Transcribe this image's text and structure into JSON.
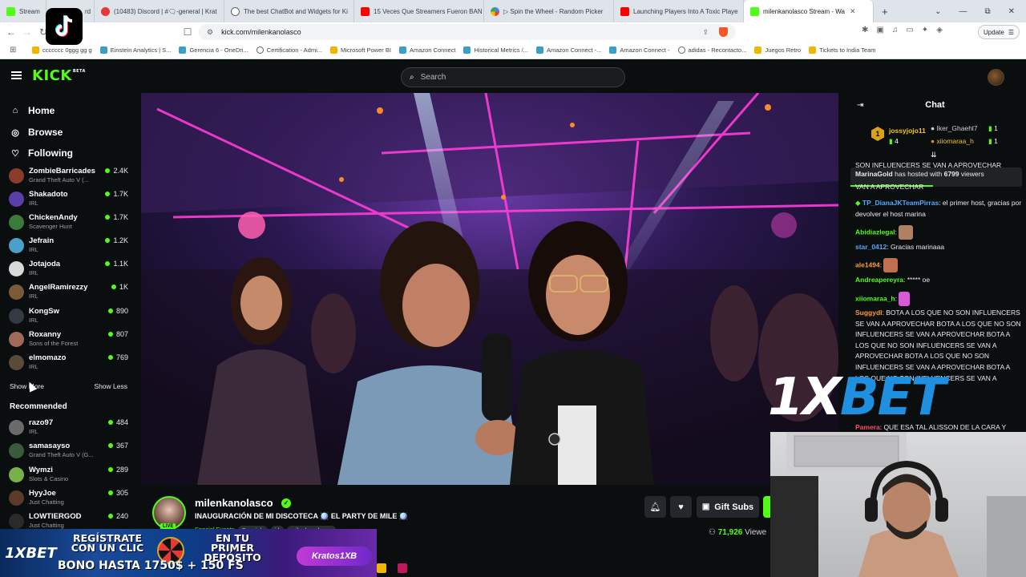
{
  "browser": {
    "tabs": [
      {
        "label": "Stream",
        "label2": "rd",
        "icon_color": "#53fc18"
      },
      {
        "label": "(10483) Discord | #🗨-general | Krat",
        "icon_color": "#e53935"
      },
      {
        "label": "The best ChatBot and Widgets for Ki",
        "icon_color": "#5f6368"
      },
      {
        "label": "15 Veces Que Streamers Fueron BAN",
        "icon_color": "#ff0000"
      },
      {
        "label": "▷ Spin the Wheel - Random Picker",
        "icon_color": "#4285f4"
      },
      {
        "label": "Launching Players Into A Toxic Playe",
        "icon_color": "#ff0000"
      },
      {
        "label": "milenkanolasco Stream - Wa",
        "icon_color": "#53fc18",
        "active": true
      }
    ],
    "new_tab": "+",
    "window_controls": [
      "⌄",
      "—",
      "⧉",
      "✕"
    ],
    "url": "kick.com/milenkanolasco",
    "update_label": "Update",
    "bookmarks": [
      {
        "label": "ccccccc 0ggg gg g",
        "icon": "folder-icon"
      },
      {
        "label": "Einstein Analytics | S...",
        "icon": "cloud-icon"
      },
      {
        "label": "Gerencia 6 - OneDri...",
        "icon": "cloud-icon"
      },
      {
        "label": "Certification - Admi...",
        "icon": "badge-icon"
      },
      {
        "label": "Microsoft Power BI",
        "icon": "folder-icon"
      },
      {
        "label": "Amazon Connect",
        "icon": "cloud-icon"
      },
      {
        "label": "Historical Metrics /...",
        "icon": "cloud-icon"
      },
      {
        "label": "Amazon Connect -...",
        "icon": "cloud-icon"
      },
      {
        "label": "Amazon Connect -",
        "icon": "cloud-icon"
      },
      {
        "label": "adidas - Recontacto...",
        "icon": "globe-icon"
      },
      {
        "label": "Juegos Retro",
        "icon": "folder-icon"
      },
      {
        "label": "Tickets to India Team",
        "icon": "folder-icon"
      }
    ]
  },
  "kick": {
    "logo": "KICK",
    "logo_badge": "BETA",
    "search_placeholder": "Search"
  },
  "sidebar": {
    "nav": [
      {
        "label": "Home",
        "icon": "home-icon",
        "glyph": "⌂"
      },
      {
        "label": "Browse",
        "icon": "compass-icon",
        "glyph": "◎"
      },
      {
        "label": "Following",
        "icon": "heart-icon",
        "glyph": "♡"
      }
    ],
    "following": [
      {
        "name": "ZombieBarricades",
        "category": "Grand Theft Auto V (...",
        "viewers": "2.4K",
        "color": "#8a3b2a"
      },
      {
        "name": "Shakadoto",
        "category": "IRL",
        "viewers": "1.7K",
        "color": "#5b3fa8"
      },
      {
        "name": "ChickenAndy",
        "category": "Scavenger Hunt",
        "viewers": "1.7K",
        "color": "#3a7a3a"
      },
      {
        "name": "Jefrain",
        "category": "IRL",
        "viewers": "1.2K",
        "color": "#4aa0c8"
      },
      {
        "name": "Jotajoda",
        "category": "IRL",
        "viewers": "1.1K",
        "color": "#d8d8d8"
      },
      {
        "name": "AngelRamirezzy",
        "category": "IRL",
        "viewers": "1K",
        "color": "#7a5a3a"
      },
      {
        "name": "KongSw",
        "category": "IRL",
        "viewers": "890",
        "color": "#333a44"
      },
      {
        "name": "Roxanny",
        "category": "Sons of the Forest",
        "viewers": "807",
        "color": "#a06a5a"
      },
      {
        "name": "elmomazo",
        "category": "IRL",
        "viewers": "769",
        "color": "#5a4a3a"
      }
    ],
    "show_more": "Show More",
    "show_less": "Show Less",
    "recommended_title": "Recommended",
    "recommended": [
      {
        "name": "razo97",
        "category": "IRL",
        "viewers": "484",
        "color": "#6a6a6a"
      },
      {
        "name": "samasayso",
        "category": "Grand Theft Auto V (G...",
        "viewers": "367",
        "color": "#3a5a3a"
      },
      {
        "name": "Wymzi",
        "category": "Slots & Casino",
        "viewers": "289",
        "color": "#7ab04a"
      },
      {
        "name": "HyyJoe",
        "category": "Just Chatting",
        "viewers": "305",
        "color": "#5a3a2a"
      },
      {
        "name": "LOWTIERGOD",
        "category": "Just Chatting",
        "viewers": "240",
        "color": "#2a2a2a"
      }
    ]
  },
  "chat": {
    "title": "Chat",
    "leaderboard": [
      {
        "rank": "1",
        "name": "jossyjojo11",
        "count": "4",
        "name_color": "#f5c518"
      },
      {
        "name": "Iker_Ghaehl7",
        "count": "1",
        "name_color": "#9aa0a6"
      },
      {
        "name": "xiiomaraa_h",
        "count": "1",
        "name_color": "#f5c518"
      }
    ],
    "pinned_partial": "SON INFLUENCERS SE VAN A APROVECHAR",
    "pinned_partial2": "VAN A APROVECHAR",
    "host_notice": {
      "user": "MarinaGold",
      "mid": "has hosted with",
      "count": "6799",
      "tail": "viewers"
    },
    "messages": [
      {
        "user": "TP_DianaJKTeamPirras",
        "color": "#53a8ff",
        "text": ": el primer host, gracias por devolver el host marina"
      },
      {
        "user": "Abidiazlegal",
        "color": "#53fc18",
        "text": ":",
        "emote": "#b08060"
      },
      {
        "user": "star_0412",
        "color": "#53a8ff",
        "text": ": Gracias marinaaa"
      },
      {
        "user": "ale1494",
        "color": "#ff9a3a",
        "text": ":",
        "emote": "#c07050"
      },
      {
        "user": "Andreapereyra",
        "color": "#53fc18",
        "text": ": ***** oe"
      },
      {
        "user": "xiiomaraa_h",
        "color": "#53fc18",
        "text": ":",
        "emote": "#d85ad8"
      },
      {
        "user": "Suggydl",
        "color": "#ff9a3a",
        "text": ": BOTA A LOS QUE NO SON INFLUENCERS SE VAN A APROVECHAR BOTA A LOS QUE NO SON INFLUENCERS SE VAN A APROVECHAR BOTA A LOS QUE NO SON INFLUENCERS SE VAN A APROVECHAR BOTA A LOS QUE NO SON INFLUENCERS SE VAN A APROVECHAR BOTA A LOS QUE NO SON INFLUENCERS SE VAN A"
      },
      {
        "user": "Pamera",
        "color": "#ff4a6a",
        "text": ": QUE ESA TAL ALISSON DE LA CARA Y"
      }
    ]
  },
  "stream": {
    "channel": "milenkanolasco",
    "title": "INAUGURACIÓN DE MI DISCOTECA 🪩 EL PARTY DE MILE 🪩",
    "category": "Special Events",
    "tags": [
      "Spanish",
      "irl",
      "milenkanolasco"
    ],
    "live_label": "LIVE",
    "gift_label": "Gift Subs",
    "viewers": "71,926",
    "viewers_label": "Viewe"
  },
  "overlays": {
    "banner_logo": "1XBET",
    "banner_line1": "REGÍSTRATE CON UN CLIC",
    "banner_line2": "EN TU PRIMER DEPÓSITO",
    "banner_line3": "BONO HASTA 1750$ + 150 FS",
    "banner_tag": "Kratos1XB",
    "xbet_a": "1X",
    "xbet_b": "BET"
  }
}
